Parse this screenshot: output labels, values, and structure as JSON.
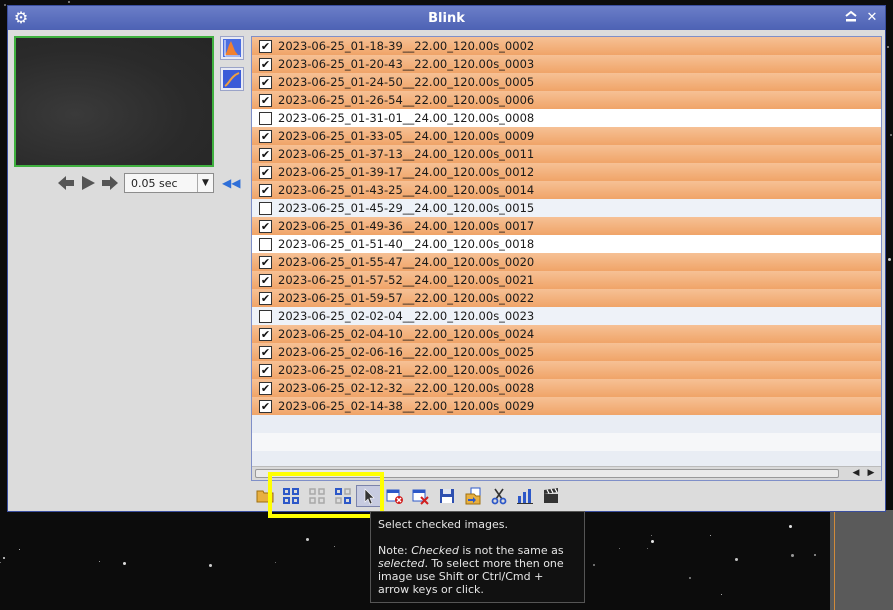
{
  "window": {
    "title": "Blink",
    "titlebar_buttons": [
      "shade-icon",
      "close-icon"
    ]
  },
  "preview": {
    "speed_select": {
      "value": "0.05 sec"
    }
  },
  "file_list": {
    "rows": [
      {
        "name": "2023-06-25_01-18-39__22.00_120.00s_0002",
        "checked": true
      },
      {
        "name": "2023-06-25_01-20-43__22.00_120.00s_0003",
        "checked": true
      },
      {
        "name": "2023-06-25_01-24-50__22.00_120.00s_0005",
        "checked": true
      },
      {
        "name": "2023-06-25_01-26-54__22.00_120.00s_0006",
        "checked": true
      },
      {
        "name": "2023-06-25_01-31-01__24.00_120.00s_0008",
        "checked": false
      },
      {
        "name": "2023-06-25_01-33-05__24.00_120.00s_0009",
        "checked": true
      },
      {
        "name": "2023-06-25_01-37-13__24.00_120.00s_0011",
        "checked": true
      },
      {
        "name": "2023-06-25_01-39-17__24.00_120.00s_0012",
        "checked": true
      },
      {
        "name": "2023-06-25_01-43-25__24.00_120.00s_0014",
        "checked": true
      },
      {
        "name": "2023-06-25_01-45-29__24.00_120.00s_0015",
        "checked": false
      },
      {
        "name": "2023-06-25_01-49-36__24.00_120.00s_0017",
        "checked": true
      },
      {
        "name": "2023-06-25_01-51-40__24.00_120.00s_0018",
        "checked": false
      },
      {
        "name": "2023-06-25_01-55-47__24.00_120.00s_0020",
        "checked": true
      },
      {
        "name": "2023-06-25_01-57-52__24.00_120.00s_0021",
        "checked": true
      },
      {
        "name": "2023-06-25_01-59-57__22.00_120.00s_0022",
        "checked": true
      },
      {
        "name": "2023-06-25_02-02-04__22.00_120.00s_0023",
        "checked": false
      },
      {
        "name": "2023-06-25_02-04-10__22.00_120.00s_0024",
        "checked": true
      },
      {
        "name": "2023-06-25_02-06-16__22.00_120.00s_0025",
        "checked": true
      },
      {
        "name": "2023-06-25_02-08-21__22.00_120.00s_0026",
        "checked": true
      },
      {
        "name": "2023-06-25_02-12-32__22.00_120.00s_0028",
        "checked": true
      },
      {
        "name": "2023-06-25_02-14-38__22.00_120.00s_0029",
        "checked": true
      }
    ],
    "colors": {
      "checked": "#f0a468",
      "unchecked": "#ffffff"
    }
  },
  "toolbar": {
    "tools": [
      "open-folder-icon",
      "select-all-icon",
      "unselect-all-icon",
      "invert-selection-icon",
      "select-checked-icon",
      "close-selected-icon",
      "close-unselected-icon",
      "save-icon",
      "copy-move-icon",
      "cut-icon",
      "statistics-icon",
      "create-movie-icon"
    ],
    "highlight_color": "#ffff00"
  },
  "tooltip": {
    "line1": "Select checked images.",
    "note_prefix": "Note: ",
    "note_checked": "Checked",
    "note_mid": " is not the same as ",
    "note_selected": "selected",
    "note_rest": ". To select more then one image use Shift or Ctrl/Cmd + arrow keys or click."
  }
}
